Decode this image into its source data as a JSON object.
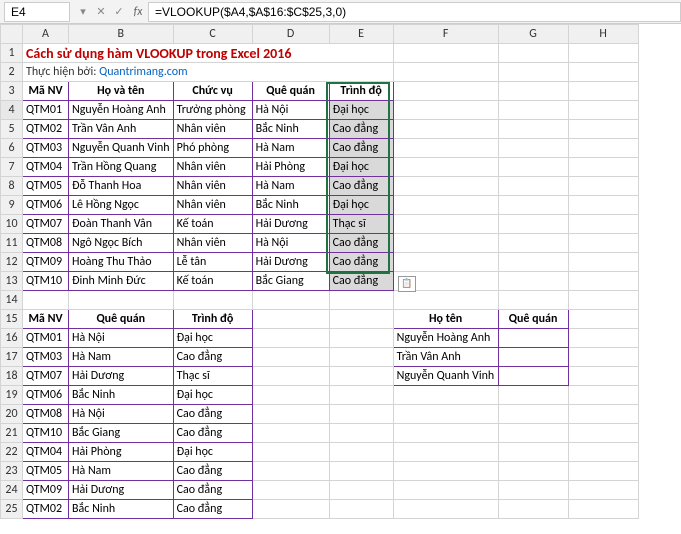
{
  "namebox": "E4",
  "formula": "=VLOOKUP($A4,$A$16:$C$25,3,0)",
  "cols": [
    "A",
    "B",
    "C",
    "D",
    "E",
    "F",
    "G",
    "H"
  ],
  "title": "Cách sử dụng hàm VLOOKUP trong Excel 2016",
  "subtitle_text": "Thực hiện bởi: ",
  "subtitle_link": "Quantrimang.com",
  "t1_headers": [
    "Mã NV",
    "Họ và tên",
    "Chức vụ",
    "Quê quán",
    "Trình độ"
  ],
  "t1_rows": [
    [
      "QTM01",
      "Nguyễn Hoàng Anh",
      "Trưởng phòng",
      "Hà Nội",
      "Đại học"
    ],
    [
      "QTM02",
      "Trần Vân Anh",
      "Nhân viên",
      "Bắc Ninh",
      "Cao đẳng"
    ],
    [
      "QTM03",
      "Nguyễn Quanh Vinh",
      "Phó phòng",
      "Hà Nam",
      "Cao đẳng"
    ],
    [
      "QTM04",
      "Trần Hồng Quang",
      "Nhân viên",
      "Hải Phòng",
      "Đại học"
    ],
    [
      "QTM05",
      "Đỗ Thanh Hoa",
      "Nhân viên",
      "Hà Nam",
      "Cao đẳng"
    ],
    [
      "QTM06",
      "Lê Hồng Ngọc",
      "Nhân viên",
      "Bắc Ninh",
      "Đại học"
    ],
    [
      "QTM07",
      "Đoàn Thanh Vân",
      "Kế toán",
      "Hải Dương",
      "Thạc sĩ"
    ],
    [
      "QTM08",
      "Ngô Ngọc Bích",
      "Nhân viên",
      "Hà Nội",
      "Cao đẳng"
    ],
    [
      "QTM09",
      "Hoàng Thu Thảo",
      "Lễ tân",
      "Hải Dương",
      "Cao đẳng"
    ],
    [
      "QTM10",
      "Đinh Minh Đức",
      "Kế toán",
      "Bắc Giang",
      "Cao đẳng"
    ]
  ],
  "t2_headers": [
    "Mã NV",
    "Quê quán",
    "Trình độ"
  ],
  "t2_rows": [
    [
      "QTM01",
      "Hà Nội",
      "Đại học"
    ],
    [
      "QTM03",
      "Hà Nam",
      "Cao đẳng"
    ],
    [
      "QTM07",
      "Hải Dương",
      "Thạc sĩ"
    ],
    [
      "QTM06",
      "Bắc Ninh",
      "Đại học"
    ],
    [
      "QTM08",
      "Hà Nội",
      "Cao đẳng"
    ],
    [
      "QTM10",
      "Bắc Giang",
      "Cao đẳng"
    ],
    [
      "QTM04",
      "Hải Phòng",
      "Đại học"
    ],
    [
      "QTM05",
      "Hà Nam",
      "Cao đẳng"
    ],
    [
      "QTM09",
      "Hải Dương",
      "Cao đẳng"
    ],
    [
      "QTM02",
      "Bắc Ninh",
      "Cao đẳng"
    ]
  ],
  "t3_headers": [
    "Họ tên",
    "Quê quán"
  ],
  "t3_rows": [
    [
      "Nguyễn Hoàng Anh",
      ""
    ],
    [
      "Trần Vân Anh",
      ""
    ],
    [
      "Nguyễn Quanh Vinh",
      ""
    ]
  ],
  "paste_icon": "📋"
}
